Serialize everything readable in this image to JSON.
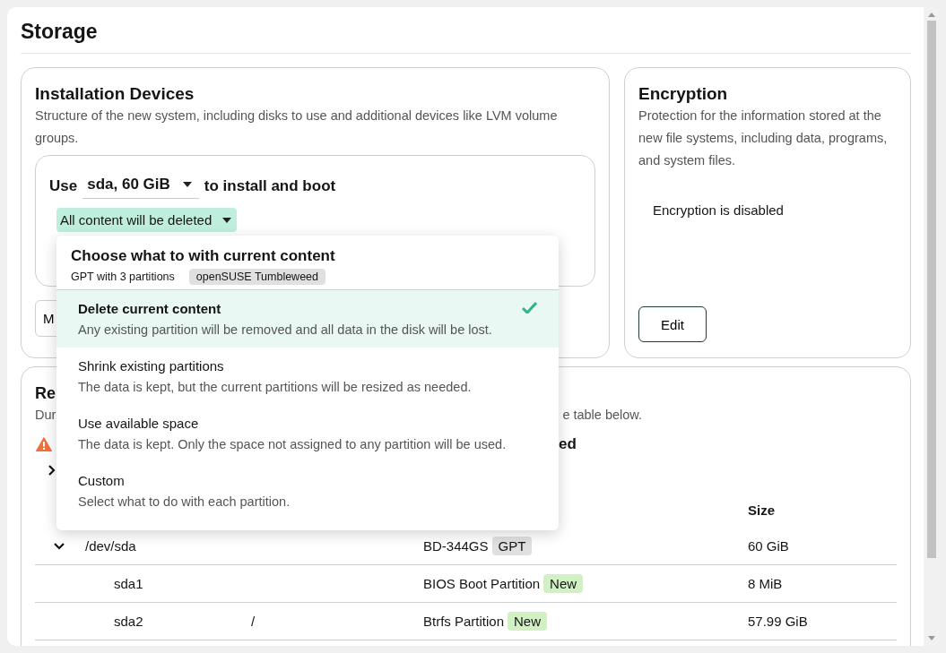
{
  "page": {
    "title": "Storage"
  },
  "installation_devices": {
    "title": "Installation Devices",
    "description": "Structure of the new system, including disks to use and additional devices like LVM volume groups.",
    "prefix": "Use",
    "device": "sda, 60 GiB",
    "suffix": "to install and boot",
    "content_action": "All content will be deleted",
    "button_fragment": "M"
  },
  "content_menu": {
    "title": "Choose what to with current content",
    "summary": "GPT with 3 partitions",
    "system_tag": "openSUSE Tumbleweed",
    "options": [
      {
        "label": "Delete current content",
        "description": "Any existing partition will be removed and all data in the disk will be lost.",
        "selected": true
      },
      {
        "label": "Shrink existing partitions",
        "description": "The data is kept, but the current partitions will be resized as needed.",
        "selected": false
      },
      {
        "label": "Use available space",
        "description": "The data is kept. Only the space not assigned to any partition will be used.",
        "selected": false
      },
      {
        "label": "Custom",
        "description": "Select what to do with each partition.",
        "selected": false
      }
    ]
  },
  "encryption": {
    "title": "Encryption",
    "description": "Protection for the information stored at the new file systems, including data, programs, and system files.",
    "status": "Encryption is disabled",
    "button": "Edit"
  },
  "result": {
    "title_fragment": "Re",
    "description_start": "Dur",
    "description_end": "e table below.",
    "warning_end": "ed",
    "details_toggle": {
      "expanded": false
    },
    "table": {
      "columns": [
        {
          "label": "Size"
        }
      ],
      "rows": [
        {
          "device": "/dev/sda",
          "details": "BD-344GS",
          "tag": {
            "label": "GPT",
            "color": "#e0e0e0"
          },
          "size": "60 GiB",
          "expanded": true,
          "children": [
            {
              "device": "sda1",
              "details": "BIOS Boot Partition",
              "tag": {
                "label": "New",
                "color": "#d1f0c4"
              },
              "size": "8 MiB"
            },
            {
              "device": "sda2",
              "mount": "/",
              "details": "Btrfs Partition",
              "tag": {
                "label": "New",
                "color": "#d1f0c4"
              },
              "size": "57.99 GiB"
            }
          ]
        }
      ]
    }
  }
}
